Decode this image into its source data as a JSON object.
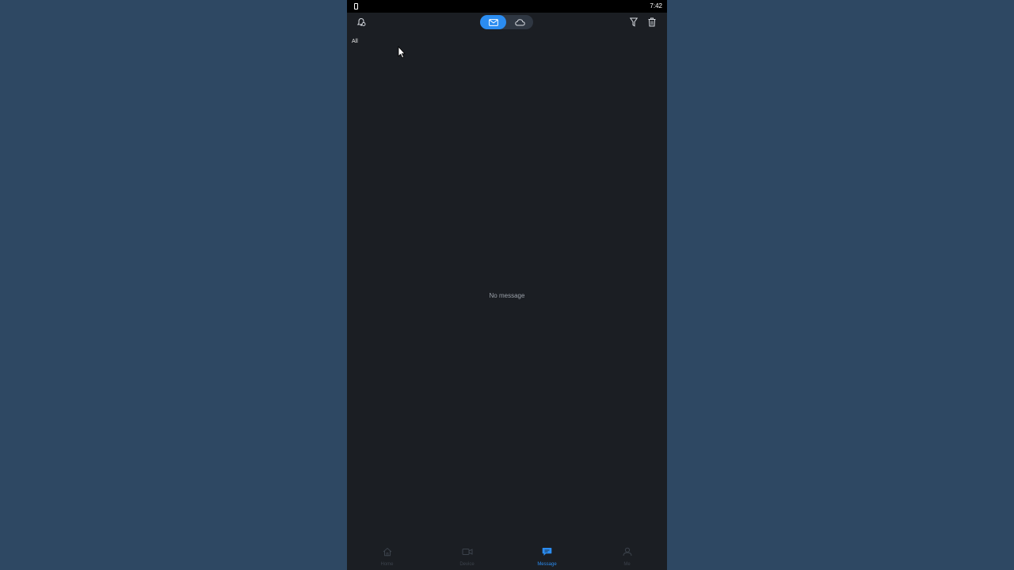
{
  "status_bar": {
    "time": "7:42"
  },
  "header": {
    "left_icon": "alarm-bell-icon",
    "segment": {
      "options": [
        {
          "icon": "mail-icon",
          "selected": true
        },
        {
          "icon": "cloud-icon",
          "selected": false
        }
      ]
    },
    "right_icons": [
      "filter-icon",
      "trash-icon"
    ]
  },
  "filter": {
    "label": "All"
  },
  "main": {
    "empty_message": "No message"
  },
  "tab_bar": {
    "tabs": [
      {
        "label": "Home",
        "icon": "home-icon",
        "active": false
      },
      {
        "label": "Device",
        "icon": "camera-icon",
        "active": false
      },
      {
        "label": "Message",
        "icon": "chat-bubble-icon",
        "active": true
      },
      {
        "label": "Me",
        "icon": "person-icon",
        "active": false
      }
    ]
  },
  "colors": {
    "background": "#2e4863",
    "app_background": "#1b1e23",
    "accent": "#2b8cf0",
    "inactive_tab": "#3c434c"
  }
}
